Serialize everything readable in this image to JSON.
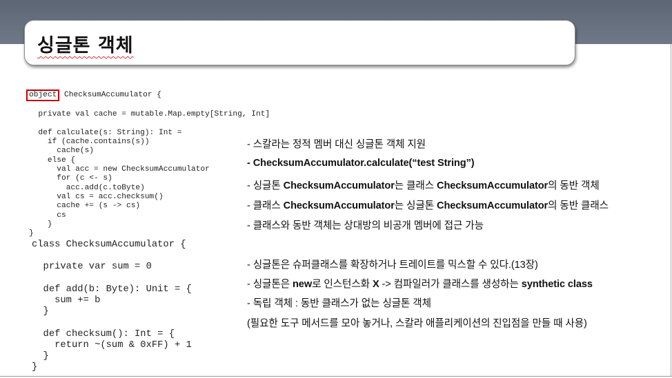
{
  "slide": {
    "title": "싱글톤 객체"
  },
  "code_top": {
    "keyword": "object",
    "first_line_rest": " ChecksumAccumulator {",
    "body": "\n\n  private val cache = mutable.Map.empty[String, Int]\n\n  def calculate(s: String): Int =\n    if (cache.contains(s))\n      cache(s)\n    else {\n      val acc = new ChecksumAccumulator\n      for (c <- s)\n        acc.add(c.toByte)\n      val cs = acc.checksum()\n      cache += (s -> cs)\n      cs\n    }\n}"
  },
  "code_bottom": {
    "text": "class ChecksumAccumulator {\n\n  private var sum = 0\n\n  def add(b: Byte): Unit = {\n    sum += b\n  }\n\n  def checksum(): Int = {\n    return ~(sum & 0xFF) + 1\n  }\n}"
  },
  "bullets": [
    "- 스칼라는 정적 멤버 대신 싱글톤 객체 지원",
    "- ChecksumAccumulator.calculate(“test String”)",
    "- 싱글톤 ChecksumAccumulator는 클래스 ChecksumAccumulator의 동반 객체",
    "- 클래스 ChecksumAccumulator는 싱글톤 ChecksumAccumulator의 동반 클래스",
    "- 클래스와 동반 객체는 상대방의 비공개 멤버에 접근 가능",
    "- 싱글톤은 슈퍼클래스를 확장하거나 트레이트를 믹스할 수 있다.(13장)",
    "- 싱글톤은 new로 인스턴스화 X -> 컴파일러가 클래스를 생성하는 synthetic class",
    "- 독립 객체 : 동반 클래스가 없는 싱글톤 객체",
    "(필요한 도구 메서드를 모아 놓거나, 스칼라 애플리케이션의 진입점을 만들 때 사용)"
  ]
}
